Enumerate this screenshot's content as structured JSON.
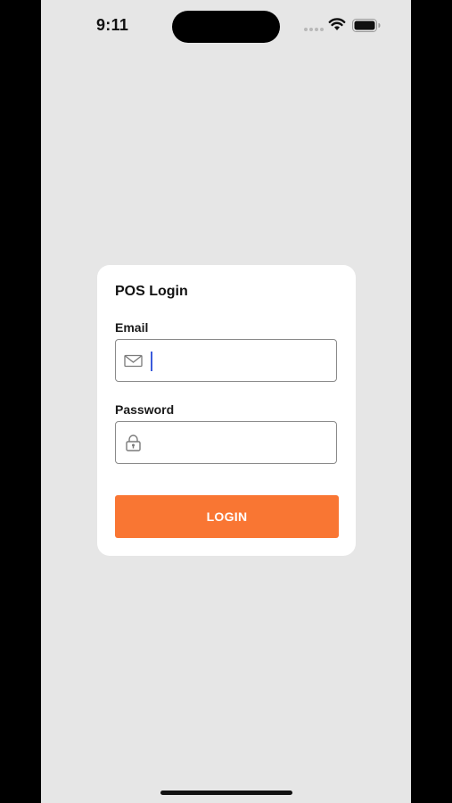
{
  "status_bar": {
    "time": "9:11"
  },
  "login": {
    "title": "POS Login",
    "email_label": "Email",
    "email_value": "",
    "password_label": "Password",
    "password_value": "",
    "button_label": "LOGIN"
  },
  "colors": {
    "background": "#e6e6e6",
    "card": "#ffffff",
    "accent": "#f97633",
    "caret": "#3b5bdb"
  },
  "icons": {
    "email": "mail-icon",
    "password": "lock-icon"
  }
}
